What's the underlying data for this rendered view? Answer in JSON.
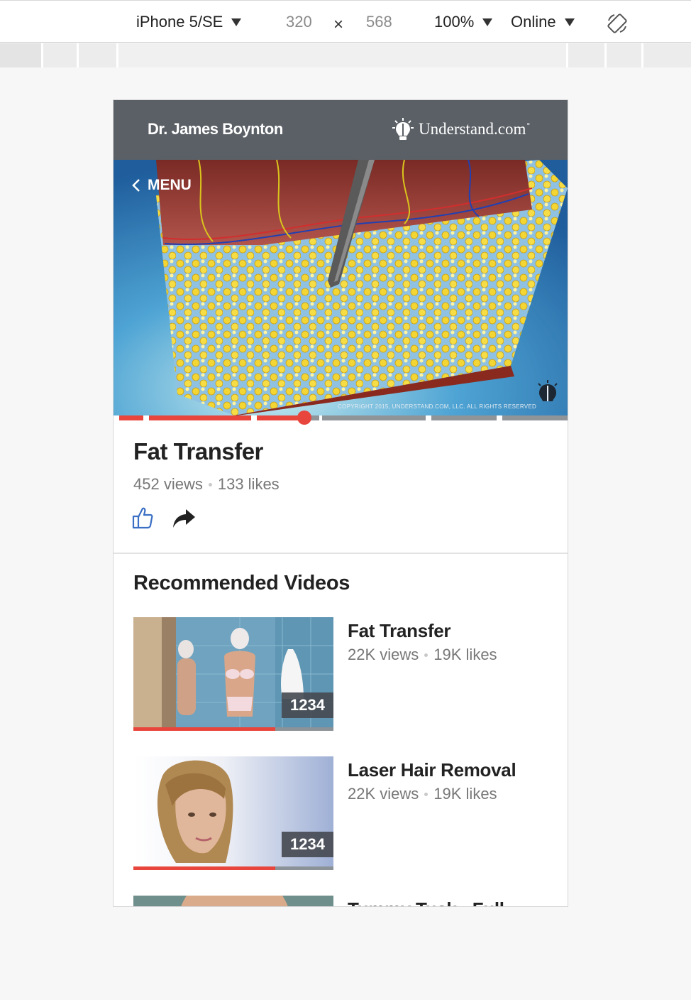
{
  "devtools": {
    "device": "iPhone 5/SE",
    "width": "320",
    "times": "×",
    "height": "568",
    "zoom": "100%",
    "network": "Online"
  },
  "header": {
    "doctor_name": "Dr. James Boynton",
    "brand": "Understand.com",
    "brand_mark": "°"
  },
  "hero": {
    "menu_label": "MENU",
    "copyright": "COPYRIGHT 2015, UNDERSTAND.COM, LLC. ALL RIGHTS RESERVED",
    "playback_progress": 0.42
  },
  "video": {
    "title": "Fat Transfer",
    "views": "452 views",
    "likes": "133 likes"
  },
  "recommended": {
    "heading": "Recommended Videos",
    "items": [
      {
        "title": "Fat Transfer",
        "views": "22K views",
        "likes": "19K likes",
        "duration": "1234",
        "progress": 0.71
      },
      {
        "title": "Laser Hair Removal",
        "views": "22K views",
        "likes": "19K likes",
        "duration": "1234",
        "progress": 0.71
      },
      {
        "title": "Tummy Tuck - Full"
      }
    ]
  },
  "colors": {
    "accent": "#e8453c",
    "header_bg": "#5b6066",
    "like_blue": "#3b6fc4"
  }
}
